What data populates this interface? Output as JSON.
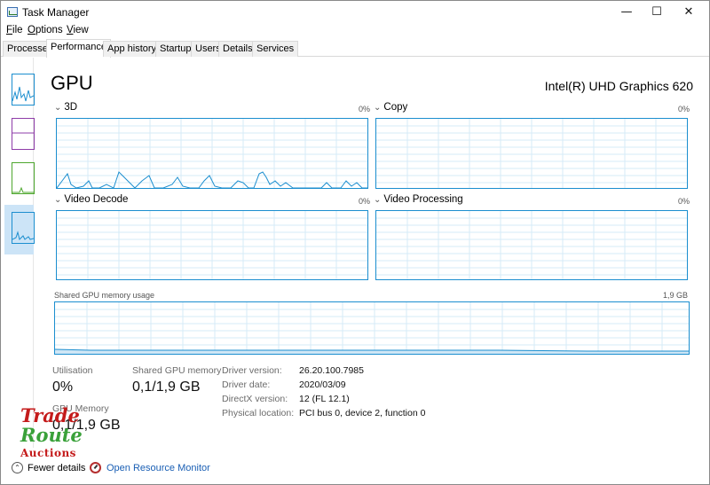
{
  "window": {
    "title": "Task Manager"
  },
  "window_controls": {
    "minimize": "—",
    "maximize": "☐",
    "close": "✕"
  },
  "menu": {
    "file": {
      "key": "F",
      "rest": "ile"
    },
    "options": {
      "key": "O",
      "rest": "ptions"
    },
    "view": {
      "key": "V",
      "rest": "iew"
    }
  },
  "tabs": [
    "Processes",
    "Performance",
    "App history",
    "Startup",
    "Users",
    "Details",
    "Services"
  ],
  "active_tab": "Performance",
  "sidebar": {
    "items": [
      {
        "color": "#1b8ecf"
      },
      {
        "color": "#8e3ca8"
      },
      {
        "color": "#4ea72e"
      },
      {
        "color": "#1b8ecf"
      }
    ]
  },
  "main": {
    "heading": "GPU",
    "device_name": "Intel(R) UHD Graphics 620",
    "graphs": [
      {
        "label": "3D",
        "percent": "0%"
      },
      {
        "label": "Copy",
        "percent": "0%"
      },
      {
        "label": "Video Decode",
        "percent": "0%"
      },
      {
        "label": "Video Processing",
        "percent": "0%"
      }
    ],
    "shared_memory": {
      "label": "Shared GPU memory usage",
      "max": "1,9 GB"
    },
    "stats": {
      "utilisation": {
        "label": "Utilisation",
        "value": "0%"
      },
      "shared_gpu_memory": {
        "label": "Shared GPU memory",
        "value": "0,1/1,9 GB"
      },
      "gpu_memory": {
        "label": "GPU Memory",
        "value": "0,1/1,9 GB"
      }
    },
    "details": [
      {
        "label": "Driver version:",
        "value": "26.20.100.7985"
      },
      {
        "label": "Driver date:",
        "value": "2020/03/09"
      },
      {
        "label": "DirectX version:",
        "value": "12 (FL 12.1)"
      },
      {
        "label": "Physical location:",
        "value": "PCI bus 0, device 2, function 0"
      }
    ]
  },
  "footer": {
    "fewer_details": "Fewer details",
    "open_resource_monitor": "Open Resource Monitor"
  },
  "watermark": {
    "line1": "Trade",
    "line2": "Route",
    "line3": "Auctions"
  },
  "colors": {
    "graph_blue": "#1b8ecf",
    "grid": "#d6ebf7",
    "link": "#1a5fb4"
  }
}
